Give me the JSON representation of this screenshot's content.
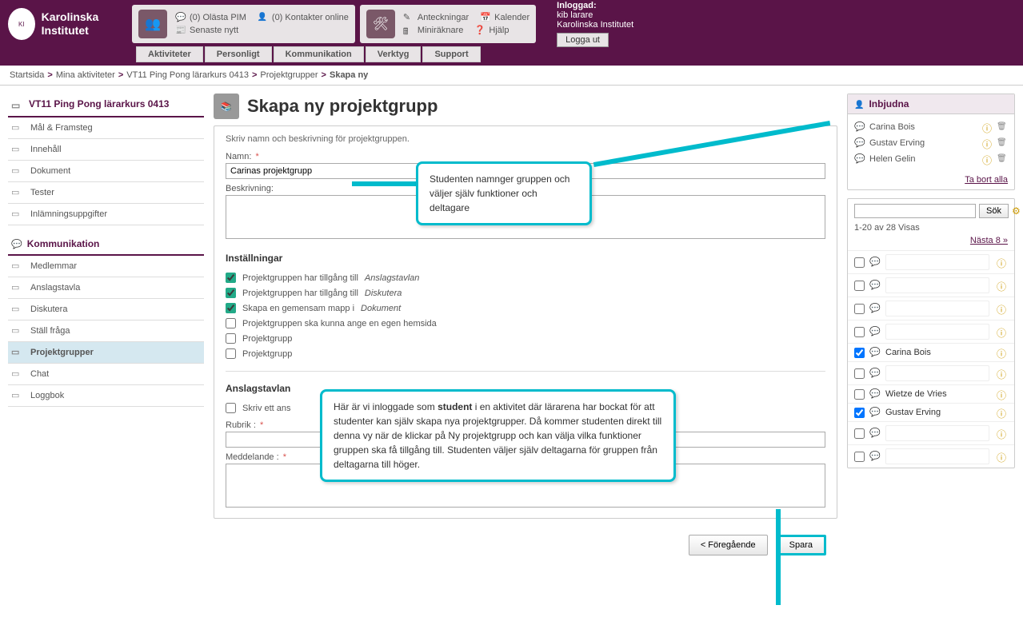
{
  "header": {
    "logo_name": "Karolinska Institutet",
    "tb1": {
      "pim": "(0) Olästa PIM",
      "kontakter": "(0) Kontakter online",
      "nytt": "Senaste nytt"
    },
    "tb2": {
      "anteckningar": "Anteckningar",
      "miniraknare": "Miniräknare",
      "kalender": "Kalender",
      "hjalp": "Hjälp"
    },
    "login": {
      "label": "Inloggad:",
      "user": "kib larare",
      "org": "Karolinska Institutet",
      "logout": "Logga ut"
    }
  },
  "tabs": [
    "Aktiviteter",
    "Personligt",
    "Kommunikation",
    "Verktyg",
    "Support"
  ],
  "breadcrumb": {
    "items": [
      "Startsida",
      "Mina aktiviteter",
      "VT11 Ping Pong lärarkurs 0413",
      "Projektgrupper"
    ],
    "current": "Skapa ny"
  },
  "sidebar": {
    "course": "VT11 Ping Pong lärarkurs 0413",
    "nav1": [
      "Mål & Framsteg",
      "Innehåll",
      "Dokument",
      "Tester",
      "Inlämningsuppgifter"
    ],
    "section2": "Kommunikation",
    "nav2": [
      "Medlemmar",
      "Anslagstavla",
      "Diskutera",
      "Ställ fråga",
      "Projektgrupper",
      "Chat",
      "Loggbok"
    ]
  },
  "main": {
    "title": "Skapa ny projektgrupp",
    "intro": "Skriv namn och beskrivning för projektgruppen.",
    "name_label": "Namn:",
    "name_value": "Carinas projektgrupp",
    "desc_label": "Beskrivning:",
    "settings_h": "Inställningar",
    "settings": [
      {
        "checked": true,
        "text": "Projektgruppen har tillgång till ",
        "em": "Anslagstavlan"
      },
      {
        "checked": true,
        "text": "Projektgruppen har tillgång till ",
        "em": "Diskutera"
      },
      {
        "checked": true,
        "text": "Skapa en gemensam mapp i ",
        "em": "Dokument"
      },
      {
        "checked": false,
        "text": "Projektgruppen ska kunna ange en egen hemsida",
        "em": ""
      },
      {
        "checked": false,
        "text": "Projektgrupp",
        "em": ""
      },
      {
        "checked": false,
        "text": "Projektgrupp",
        "em": ""
      }
    ],
    "anslag_h": "Anslagstavlan",
    "anslag_chk": "Skriv ett ans",
    "rubrik_label": "Rubrik :",
    "meddelande_label": "Meddelande :",
    "prev": "< Föregående",
    "save": "Spara"
  },
  "right": {
    "invited_h": "Inbjudna",
    "invited": [
      "Carina Bois",
      "Gustav Erving",
      "Helen Gelin"
    ],
    "remove_all": "Ta bort alla",
    "search_btn": "Sök",
    "result_meta": "1-20 av 28 Visas",
    "next": "Nästa 8 »",
    "users": [
      {
        "checked": false,
        "name": ""
      },
      {
        "checked": false,
        "name": ""
      },
      {
        "checked": false,
        "name": ""
      },
      {
        "checked": false,
        "name": ""
      },
      {
        "checked": true,
        "name": "Carina Bois"
      },
      {
        "checked": false,
        "name": ""
      },
      {
        "checked": false,
        "name": "Wietze de Vries"
      },
      {
        "checked": true,
        "name": "Gustav Erving"
      },
      {
        "checked": false,
        "name": ""
      },
      {
        "checked": false,
        "name": ""
      }
    ]
  },
  "callouts": {
    "c1": "Studenten namnger gruppen och väljer själv funktioner och deltagare",
    "c2_pre": "Här är vi inloggade som ",
    "c2_bold": "student",
    "c2_post": " i en aktivitet där lärarena har bockat för att studenter kan själv skapa nya projektgrupper. Då kommer studenten direkt till denna vy när de klickar på Ny projektgrupp och kan välja vilka funktioner gruppen ska få tillgång till. Studenten väljer själv deltagarna för gruppen från deltagarna till höger."
  }
}
